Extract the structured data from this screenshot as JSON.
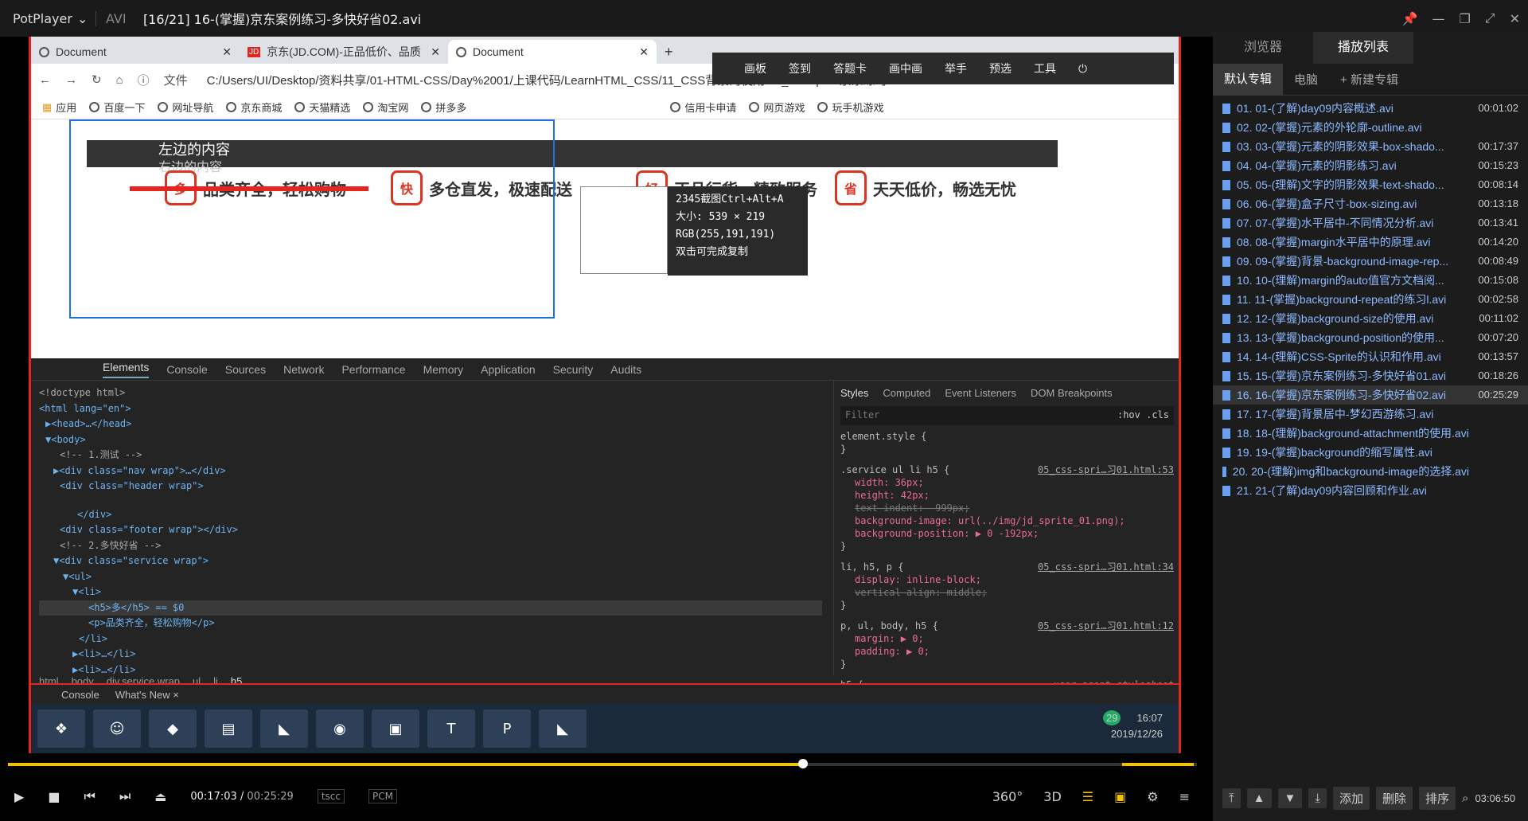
{
  "player": {
    "brand": "PotPlayer",
    "format": "AVI",
    "title": "[16/21] 16-(掌握)京东案例练习-多快好省02.avi",
    "current_time": "00:17:03",
    "total_time": "00:25:29",
    "codec1": "tscc",
    "codec2": "PCM",
    "progress": 0.669,
    "volume": 1.0
  },
  "chrome": {
    "tabs": [
      "Document",
      "京东(JD.COM)-正品低价、品质",
      "Document"
    ],
    "url": "C:/Users/UI/Desktop/资料共享/01-HTML-CSS/Day%2001/上课代码/LearnHTML_CSS/11_CSS背景的使用/05_css-sprite京东练习01.html",
    "file_label": "文件",
    "bookmarks": [
      "应用",
      "百度一下",
      "网址导航",
      "京东商城",
      "天猫精选",
      "淘宝网",
      "拼多多",
      "信用卡申请",
      "网页游戏",
      "玩手机游戏"
    ]
  },
  "screenshot_tool": {
    "toolbar": [
      "画板",
      "签到",
      "答题卡",
      "画中画",
      "举手",
      "预选",
      "工具"
    ],
    "title": "2345截图Ctrl+Alt+A",
    "size": "大小: 539 × 219",
    "rgb": "RGB(255,191,191)",
    "hint": "双击可完成复制"
  },
  "page": {
    "left": "左边的内容",
    "right": "右边的内容",
    "services": [
      {
        "icon": "多",
        "text": "品类齐全，轻松购物"
      },
      {
        "icon": "快",
        "text": "多仓直发，极速配送"
      },
      {
        "icon": "好",
        "text": "正品行货，精致服务"
      },
      {
        "icon": "省",
        "text": "天天低价，畅选无忧"
      }
    ]
  },
  "devtools": {
    "tabs": [
      "Elements",
      "Console",
      "Sources",
      "Network",
      "Performance",
      "Memory",
      "Application",
      "Security",
      "Audits"
    ],
    "dom": [
      "<!doctype html>",
      "<html lang=\"en\">",
      "▶<head>…</head>",
      "▼<body>",
      "<!-- 1.测试 -->",
      "▶<div class=\"nav wrap\">…</div>",
      "<div class=\"header wrap\">",
      "</div>",
      "<div class=\"footer wrap\"></div>",
      "<!-- 2.多快好省 -->",
      "▼<div class=\"service wrap\">",
      "▼<ul>",
      "▼<li>",
      "<h5>多</h5> == $0",
      "<p>品类齐全，轻松购物</p>",
      "</li>",
      "▶<li>…</li>",
      "▶<li>…</li>"
    ],
    "crumbs": [
      "html",
      "body",
      "div.service.wrap",
      "ul",
      "li",
      "h5"
    ],
    "style_tabs": [
      "Styles",
      "Computed",
      "Event Listeners",
      "DOM Breakpoints"
    ],
    "filter": "Filter",
    "hov": ":hov .cls",
    "rules": [
      {
        "sel": "element.style {",
        "src": "",
        "props": []
      },
      {
        "sel": ".service ul li h5 {",
        "src": "05_css-spri…习01.html:53",
        "props": [
          "width: 36px;",
          "height: 42px;",
          "text-indent: -999px;",
          "background-image: url(../img/jd_sprite_01.png);",
          "background-position: ▶ 0 -192px;"
        ]
      },
      {
        "sel": "li, h5, p {",
        "src": "05_css-spri…习01.html:34",
        "props": [
          "display: inline-block;",
          "vertical-align: middle;"
        ]
      },
      {
        "sel": "p, ul, body, h5 {",
        "src": "05_css-spri…习01.html:12",
        "props": [
          "margin: ▶ 0;",
          "padding: ▶ 0;"
        ]
      },
      {
        "sel": "h5 {",
        "src": "user agent stylesheet",
        "props": []
      }
    ],
    "drawer": [
      "Console",
      "What's New ×"
    ]
  },
  "taskbar": {
    "time": "16:07",
    "date": "2019/12/26",
    "badge": "29"
  },
  "playlist": {
    "tabs": [
      "浏览器",
      "播放列表"
    ],
    "sub": [
      "默认专辑",
      "电脑",
      "+ 新建专辑"
    ],
    "items": [
      [
        "01. 01-(了解)day09内容概述.avi",
        "00:01:02"
      ],
      [
        "02. 02-(掌握)元素的外轮廓-outline.avi",
        ""
      ],
      [
        "03. 03-(掌握)元素的阴影效果-box-shado...",
        "00:17:37"
      ],
      [
        "04. 04-(掌握)元素的阴影练习.avi",
        "00:15:23"
      ],
      [
        "05. 05-(理解)文字的阴影效果-text-shado...",
        "00:08:14"
      ],
      [
        "06. 06-(掌握)盒子尺寸-box-sizing.avi",
        "00:13:18"
      ],
      [
        "07. 07-(掌握)水平居中-不同情况分析.avi",
        "00:13:41"
      ],
      [
        "08. 08-(掌握)margin水平居中的原理.avi",
        "00:14:20"
      ],
      [
        "09. 09-(掌握)背景-background-image-rep...",
        "00:08:49"
      ],
      [
        "10. 10-(理解)margin的auto值官方文档阅...",
        "00:15:08"
      ],
      [
        "11. 11-(掌握)background-repeat的练习l.avi",
        "00:02:58"
      ],
      [
        "12. 12-(掌握)background-size的使用.avi",
        "00:11:02"
      ],
      [
        "13. 13-(掌握)background-position的使用...",
        "00:07:20"
      ],
      [
        "14. 14-(理解)CSS-Sprite的认识和作用.avi",
        "00:13:57"
      ],
      [
        "15. 15-(掌握)京东案例练习-多快好省01.avi",
        "00:18:26"
      ],
      [
        "16. 16-(掌握)京东案例练习-多快好省02.avi",
        "00:25:29"
      ],
      [
        "17. 17-(掌握)背景居中-梦幻西游练习.avi",
        ""
      ],
      [
        "18. 18-(理解)background-attachment的使用.avi",
        ""
      ],
      [
        "19. 19-(掌握)background的缩写属性.avi",
        ""
      ],
      [
        "20. 20-(理解)img和background-image的选择.avi",
        ""
      ],
      [
        "21. 21-(了解)day09内容回顾和作业.avi",
        ""
      ]
    ],
    "buttons": [
      "添加",
      "删除",
      "排序"
    ],
    "total": "03:06:50"
  }
}
